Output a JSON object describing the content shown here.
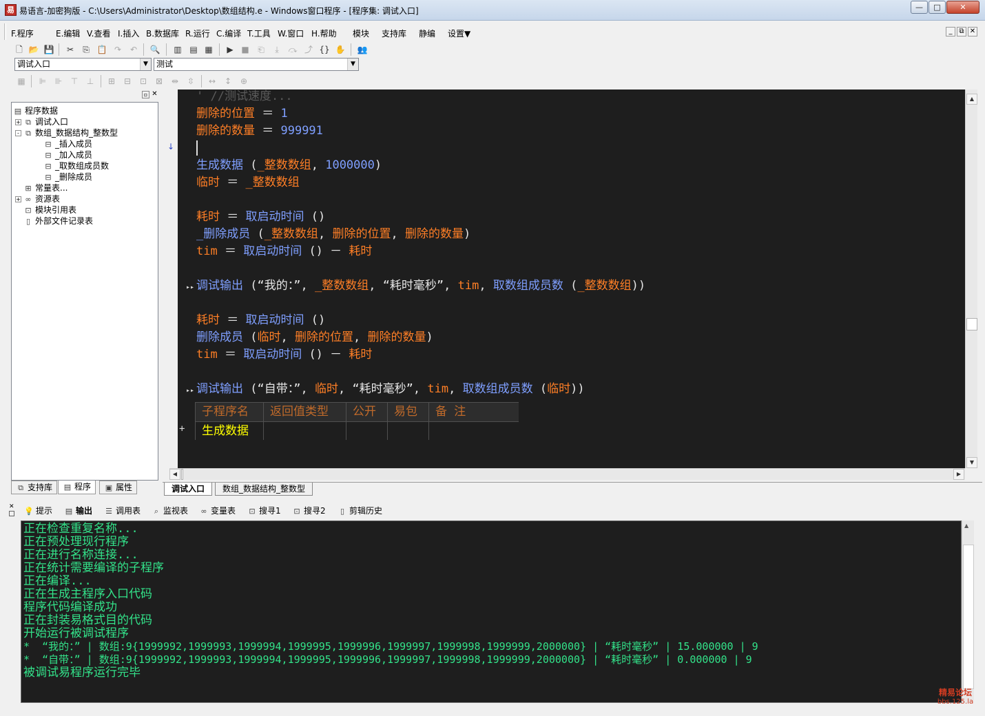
{
  "window": {
    "title": "易语言-加密狗版 - C:\\Users\\Administrator\\Desktop\\数组结构.e - Windows窗口程序 - [程序集: 调试入口]",
    "min": "—",
    "max": "□",
    "close": "✕"
  },
  "menu": {
    "items": [
      "F.程序",
      "E.编辑",
      "V.查看",
      "I.插入",
      "B.数据库",
      "R.运行",
      "C.编译",
      "T.工具",
      "W.窗口",
      "H.帮助",
      "模块",
      "支持库",
      "静编",
      "设置▼"
    ],
    "mdi_min": "_",
    "mdi_restore": "⧉",
    "mdi_close": "✕"
  },
  "combos": {
    "left": "调试入口",
    "right": "测试"
  },
  "tree": {
    "root": "程序数据",
    "items": [
      {
        "label": "调试入口",
        "expander": "+"
      },
      {
        "label": "数组_数据结构_整数型",
        "expander": "-"
      },
      {
        "label": "_插入成员"
      },
      {
        "label": "_加入成员"
      },
      {
        "label": "_取数组成员数"
      },
      {
        "label": "_删除成员"
      },
      {
        "label": "常量表..."
      },
      {
        "label": "资源表",
        "expander": "+"
      },
      {
        "label": "模块引用表"
      },
      {
        "label": "外部文件记录表"
      }
    ]
  },
  "panel_tabs": [
    "支持库",
    "程序",
    "属性"
  ],
  "code": {
    "comment": "' //测试速度...",
    "line1_var": "删除的位置",
    "line1_val": "1",
    "line2_var": "删除的数量",
    "line2_val": "999991",
    "l4_fn": "生成数据",
    "l4_args": "_整数数组",
    "l4_num": "1000000",
    "l5_var": "临时",
    "l5_val": "_整数数组",
    "l7_var": "耗时",
    "l7_fn": "取启动时间",
    "l8_fn": "_删除成员",
    "l8_a1": "_整数数组",
    "l8_a2": "删除的位置",
    "l8_a3": "删除的数量",
    "l9_var": "tim",
    "l9_fn": "取启动时间",
    "l9_minus": "耗时",
    "l11_fn": "调试输出",
    "l11_s1": "“我的：”",
    "l11_a1": "_整数数组",
    "l11_s2": "“耗时毫秒”",
    "l11_a2": "tim",
    "l11_fn2": "取数组成员数",
    "l11_a3": "_整数数组",
    "l13_var": "耗时",
    "l13_fn": "取启动时间",
    "l14_fn": "删除成员",
    "l14_a1": "临时",
    "l14_a2": "删除的位置",
    "l14_a3": "删除的数量",
    "l15_var": "tim",
    "l15_fn": "取启动时间",
    "l15_minus": "耗时",
    "l17_fn": "调试输出",
    "l17_s1": "“自带：”",
    "l17_a1": "临时",
    "l17_s2": "“耗时毫秒”",
    "l17_a2": "tim",
    "l17_fn2": "取数组成员数",
    "l17_a3": "临时"
  },
  "subtable": {
    "headers": [
      "子程序名",
      "返回值类型",
      "公开",
      "易包",
      "备 注"
    ],
    "row_name": "生成数据",
    "expander": "+"
  },
  "doc_tabs": [
    "调试入口",
    "数组_数据结构_整数型"
  ],
  "bottom_tabs": [
    "提示",
    "输出",
    "调用表",
    "监视表",
    "变量表",
    "搜寻1",
    "搜寻2",
    "剪辑历史"
  ],
  "output": [
    "正在检查重复名称...",
    "正在预处理现行程序",
    "正在进行名称连接...",
    "正在统计需要编译的子程序",
    "正在编译...",
    "正在生成主程序入口代码",
    "程序代码编译成功",
    "正在封装易格式目的代码",
    "开始运行被调试程序",
    "*  “我的：” | 数组:9{1999992,1999993,1999994,1999995,1999996,1999997,1999998,1999999,2000000} | “耗时毫秒” | 15.000000 | 9",
    "*  “自带：” | 数组:9{1999992,1999993,1999994,1999995,1999996,1999997,1999998,1999999,2000000} | “耗时毫秒” | 0.000000 | 9",
    "被调试易程序运行完毕"
  ],
  "watermark": {
    "line1": "精易论坛",
    "line2": "bbs.125.la"
  },
  "colors": {
    "keyword": "#ff7f26",
    "function": "#7f9fff",
    "output_text": "#33e38a",
    "editor_bg": "#1e1e1e"
  }
}
